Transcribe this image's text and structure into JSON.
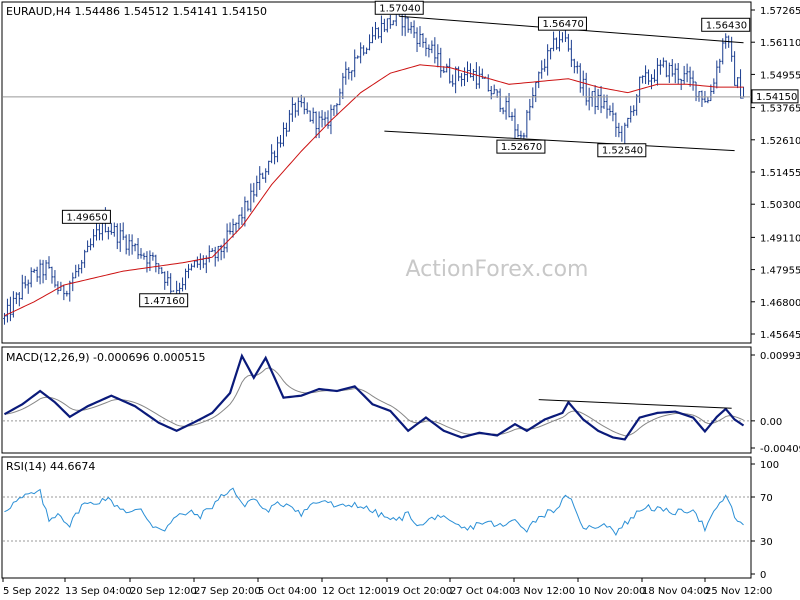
{
  "symbol_line": "EURAUD,H4  1.54486 1.54512 1.54141 1.54150",
  "watermark": "ActionForex.com",
  "current_price_label": "1.54150",
  "colors": {
    "candle": "#1a3d8f",
    "ma": "#cc1111",
    "macd": "#0a1a7a",
    "signal": "#888888",
    "rsi": "#2a8fd6",
    "grid": "#999999",
    "watermark": "#c8c8c8"
  },
  "chart_data": [
    {
      "panel": "price",
      "type": "candlestick",
      "title": "EURAUD,H4",
      "ohlc_last": {
        "open": 1.54486,
        "high": 1.54512,
        "low": 1.54141,
        "close": 1.5415
      },
      "ylim": [
        1.45645,
        1.57265
      ],
      "y_ticks": [
        "1.57265",
        "1.56110",
        "1.54955",
        "1.53765",
        "1.52610",
        "1.51455",
        "1.50300",
        "1.49110",
        "1.47955",
        "1.46800",
        "1.45645"
      ],
      "x_ticks": [
        "5 Sep 2022",
        "13 Sep 04:00",
        "20 Sep 12:00",
        "27 Sep 20:00",
        "5 Oct 04:00",
        "12 Oct 12:00",
        "19 Oct 20:00",
        "27 Oct 04:00",
        "3 Nov 12:00",
        "10 Nov 20:00",
        "18 Nov 04:00",
        "25 Nov 12:00"
      ],
      "path_keypoints": [
        {
          "x": 0,
          "y": 1.462
        },
        {
          "x": 8,
          "y": 1.476
        },
        {
          "x": 14,
          "y": 1.48
        },
        {
          "x": 19,
          "y": 1.471
        },
        {
          "x": 26,
          "y": 1.481
        },
        {
          "x": 33,
          "y": 1.4965
        },
        {
          "x": 42,
          "y": 1.489
        },
        {
          "x": 52,
          "y": 1.481
        },
        {
          "x": 57,
          "y": 1.4716
        },
        {
          "x": 64,
          "y": 1.481
        },
        {
          "x": 72,
          "y": 1.485
        },
        {
          "x": 82,
          "y": 1.503
        },
        {
          "x": 92,
          "y": 1.525
        },
        {
          "x": 98,
          "y": 1.538
        },
        {
          "x": 108,
          "y": 1.531
        },
        {
          "x": 118,
          "y": 1.556
        },
        {
          "x": 126,
          "y": 1.566
        },
        {
          "x": 133,
          "y": 1.5704
        },
        {
          "x": 142,
          "y": 1.56
        },
        {
          "x": 150,
          "y": 1.549
        },
        {
          "x": 158,
          "y": 1.55
        },
        {
          "x": 168,
          "y": 1.539
        },
        {
          "x": 174,
          "y": 1.5267
        },
        {
          "x": 181,
          "y": 1.552
        },
        {
          "x": 188,
          "y": 1.5647
        },
        {
          "x": 196,
          "y": 1.542
        },
        {
          "x": 203,
          "y": 1.538
        },
        {
          "x": 208,
          "y": 1.5254
        },
        {
          "x": 214,
          "y": 1.546
        },
        {
          "x": 222,
          "y": 1.552
        },
        {
          "x": 230,
          "y": 1.548
        },
        {
          "x": 237,
          "y": 1.54
        },
        {
          "x": 243,
          "y": 1.5643
        },
        {
          "x": 246,
          "y": 1.548
        },
        {
          "x": 249,
          "y": 1.5415
        }
      ],
      "ma_keypoints": [
        {
          "x": 0,
          "y": 1.463
        },
        {
          "x": 10,
          "y": 1.468
        },
        {
          "x": 20,
          "y": 1.474
        },
        {
          "x": 40,
          "y": 1.479
        },
        {
          "x": 60,
          "y": 1.482
        },
        {
          "x": 70,
          "y": 1.484
        },
        {
          "x": 80,
          "y": 1.495
        },
        {
          "x": 90,
          "y": 1.51
        },
        {
          "x": 100,
          "y": 1.522
        },
        {
          "x": 110,
          "y": 1.533
        },
        {
          "x": 120,
          "y": 1.543
        },
        {
          "x": 130,
          "y": 1.55
        },
        {
          "x": 140,
          "y": 1.553
        },
        {
          "x": 150,
          "y": 1.552
        },
        {
          "x": 160,
          "y": 1.549
        },
        {
          "x": 170,
          "y": 1.546
        },
        {
          "x": 180,
          "y": 1.547
        },
        {
          "x": 190,
          "y": 1.548
        },
        {
          "x": 200,
          "y": 1.545
        },
        {
          "x": 210,
          "y": 1.543
        },
        {
          "x": 220,
          "y": 1.546
        },
        {
          "x": 230,
          "y": 1.546
        },
        {
          "x": 240,
          "y": 1.545
        },
        {
          "x": 249,
          "y": 1.545
        }
      ],
      "annotations": [
        {
          "text": "1.57040",
          "x": 133,
          "y": 1.5704
        },
        {
          "text": "1.56470",
          "x": 188,
          "y": 1.5647
        },
        {
          "text": "1.56430",
          "x": 243,
          "y": 1.5643
        },
        {
          "text": "1.52670",
          "x": 174,
          "y": 1.5267
        },
        {
          "text": "1.52540",
          "x": 208,
          "y": 1.5254
        },
        {
          "text": "1.49650",
          "x": 33,
          "y": 1.4965
        },
        {
          "text": "1.47160",
          "x": 57,
          "y": 1.4716
        }
      ],
      "trendlines": [
        {
          "x1": 133,
          "y1": 1.5704,
          "x2": 249,
          "y2": 1.5609
        },
        {
          "x1": 128,
          "y1": 1.5292,
          "x2": 246,
          "y2": 1.5222
        }
      ],
      "current_price": 1.5415
    },
    {
      "panel": "macd",
      "type": "line",
      "title": "MACD(12,26,9) -0.000696 0.000515",
      "ylim": [
        -0.004095,
        0.009934
      ],
      "y_ticks": [
        "0.009934",
        "0.00",
        "-0.004095"
      ],
      "zero_line": 0,
      "macd_keypoints": [
        {
          "x": 0,
          "y": 0.001
        },
        {
          "x": 6,
          "y": 0.0025
        },
        {
          "x": 12,
          "y": 0.0045
        },
        {
          "x": 17,
          "y": 0.0028
        },
        {
          "x": 22,
          "y": 0.0006
        },
        {
          "x": 28,
          "y": 0.0022
        },
        {
          "x": 36,
          "y": 0.0038
        },
        {
          "x": 44,
          "y": 0.0022
        },
        {
          "x": 52,
          "y": -0.0003
        },
        {
          "x": 58,
          "y": -0.0015
        },
        {
          "x": 64,
          "y": -0.0002
        },
        {
          "x": 70,
          "y": 0.0012
        },
        {
          "x": 76,
          "y": 0.0042
        },
        {
          "x": 80,
          "y": 0.0098
        },
        {
          "x": 84,
          "y": 0.0065
        },
        {
          "x": 88,
          "y": 0.0095
        },
        {
          "x": 94,
          "y": 0.0035
        },
        {
          "x": 100,
          "y": 0.0038
        },
        {
          "x": 106,
          "y": 0.0048
        },
        {
          "x": 112,
          "y": 0.0045
        },
        {
          "x": 118,
          "y": 0.0052
        },
        {
          "x": 124,
          "y": 0.0025
        },
        {
          "x": 130,
          "y": 0.0015
        },
        {
          "x": 136,
          "y": -0.0015
        },
        {
          "x": 142,
          "y": 0.0005
        },
        {
          "x": 148,
          "y": -0.0015
        },
        {
          "x": 154,
          "y": -0.0025
        },
        {
          "x": 160,
          "y": -0.0018
        },
        {
          "x": 166,
          "y": -0.0022
        },
        {
          "x": 172,
          "y": -0.0005
        },
        {
          "x": 176,
          "y": -0.0015
        },
        {
          "x": 182,
          "y": 0.0002
        },
        {
          "x": 188,
          "y": 0.0012
        },
        {
          "x": 190,
          "y": 0.0028
        },
        {
          "x": 195,
          "y": 0.0002
        },
        {
          "x": 200,
          "y": -0.0015
        },
        {
          "x": 205,
          "y": -0.0025
        },
        {
          "x": 209,
          "y": -0.0028
        },
        {
          "x": 214,
          "y": 0.0005
        },
        {
          "x": 220,
          "y": 0.0012
        },
        {
          "x": 226,
          "y": 0.0014
        },
        {
          "x": 232,
          "y": 0.0005
        },
        {
          "x": 236,
          "y": -0.0016
        },
        {
          "x": 240,
          "y": 0.0006
        },
        {
          "x": 243,
          "y": 0.0018
        },
        {
          "x": 246,
          "y": 0.0002
        },
        {
          "x": 249,
          "y": -0.0007
        }
      ],
      "trendline": {
        "x1": 180,
        "y1": 0.0032,
        "x2": 245,
        "y2": 0.0019
      }
    },
    {
      "panel": "rsi",
      "type": "line",
      "title": "RSI(14) 44.6674",
      "ylim": [
        0,
        100
      ],
      "y_ticks": [
        "100",
        "70",
        "30",
        "0"
      ],
      "levels": [
        70,
        30
      ],
      "rsi_keypoints": [
        {
          "x": 0,
          "y": 58
        },
        {
          "x": 4,
          "y": 66
        },
        {
          "x": 8,
          "y": 72
        },
        {
          "x": 12,
          "y": 74
        },
        {
          "x": 15,
          "y": 48
        },
        {
          "x": 18,
          "y": 56
        },
        {
          "x": 22,
          "y": 44
        },
        {
          "x": 26,
          "y": 63
        },
        {
          "x": 30,
          "y": 64
        },
        {
          "x": 34,
          "y": 69
        },
        {
          "x": 38,
          "y": 62
        },
        {
          "x": 42,
          "y": 56
        },
        {
          "x": 46,
          "y": 58
        },
        {
          "x": 50,
          "y": 44
        },
        {
          "x": 54,
          "y": 41
        },
        {
          "x": 58,
          "y": 52
        },
        {
          "x": 62,
          "y": 56
        },
        {
          "x": 66,
          "y": 53
        },
        {
          "x": 70,
          "y": 62
        },
        {
          "x": 74,
          "y": 73
        },
        {
          "x": 77,
          "y": 78
        },
        {
          "x": 80,
          "y": 62
        },
        {
          "x": 84,
          "y": 69
        },
        {
          "x": 88,
          "y": 57
        },
        {
          "x": 92,
          "y": 63
        },
        {
          "x": 96,
          "y": 64
        },
        {
          "x": 100,
          "y": 55
        },
        {
          "x": 104,
          "y": 64
        },
        {
          "x": 108,
          "y": 67
        },
        {
          "x": 112,
          "y": 60
        },
        {
          "x": 118,
          "y": 64
        },
        {
          "x": 124,
          "y": 57
        },
        {
          "x": 128,
          "y": 52
        },
        {
          "x": 132,
          "y": 48
        },
        {
          "x": 136,
          "y": 55
        },
        {
          "x": 140,
          "y": 43
        },
        {
          "x": 146,
          "y": 54
        },
        {
          "x": 150,
          "y": 46
        },
        {
          "x": 156,
          "y": 40
        },
        {
          "x": 160,
          "y": 47
        },
        {
          "x": 164,
          "y": 46
        },
        {
          "x": 168,
          "y": 43
        },
        {
          "x": 172,
          "y": 49
        },
        {
          "x": 176,
          "y": 41
        },
        {
          "x": 180,
          "y": 52
        },
        {
          "x": 186,
          "y": 60
        },
        {
          "x": 190,
          "y": 72
        },
        {
          "x": 194,
          "y": 45
        },
        {
          "x": 198,
          "y": 41
        },
        {
          "x": 202,
          "y": 47
        },
        {
          "x": 206,
          "y": 38
        },
        {
          "x": 210,
          "y": 48
        },
        {
          "x": 216,
          "y": 62
        },
        {
          "x": 222,
          "y": 57
        },
        {
          "x": 228,
          "y": 56
        },
        {
          "x": 232,
          "y": 60
        },
        {
          "x": 236,
          "y": 41
        },
        {
          "x": 240,
          "y": 59
        },
        {
          "x": 243,
          "y": 72
        },
        {
          "x": 246,
          "y": 52
        },
        {
          "x": 249,
          "y": 44.67
        }
      ]
    }
  ]
}
